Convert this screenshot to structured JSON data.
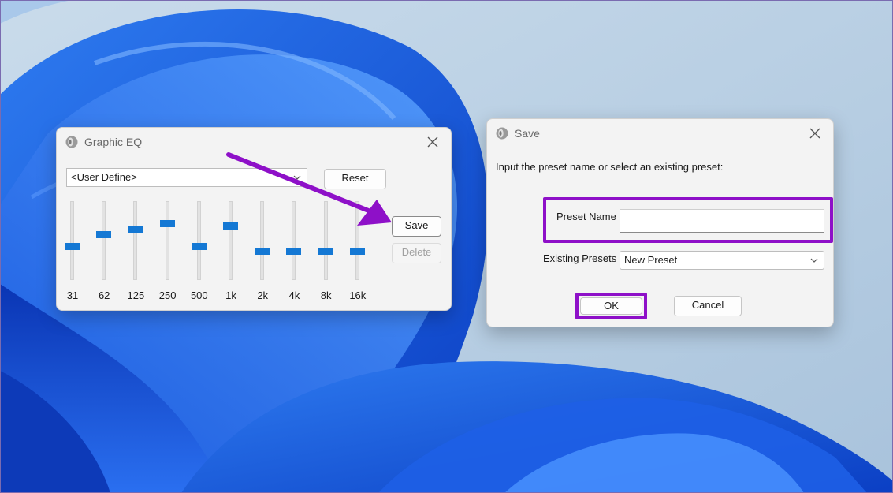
{
  "eq_window": {
    "title": "Graphic EQ",
    "preset_selected": "<User Define>",
    "reset_label": "Reset",
    "save_label": "Save",
    "delete_label": "Delete",
    "bands": [
      {
        "label": "31",
        "level": 0.57
      },
      {
        "label": "62",
        "level": 0.42
      },
      {
        "label": "125",
        "level": 0.35
      },
      {
        "label": "250",
        "level": 0.28
      },
      {
        "label": "500",
        "level": 0.57
      },
      {
        "label": "1k",
        "level": 0.31
      },
      {
        "label": "2k",
        "level": 0.63
      },
      {
        "label": "4k",
        "level": 0.63
      },
      {
        "label": "8k",
        "level": 0.63
      },
      {
        "label": "16k",
        "level": 0.63
      }
    ]
  },
  "save_dialog": {
    "title": "Save",
    "instruction": "Input the preset name or select an existing preset:",
    "preset_name_label": "Preset Name",
    "preset_name_value": "",
    "existing_presets_label": "Existing Presets",
    "existing_presets_selected": "New Preset",
    "ok_label": "OK",
    "cancel_label": "Cancel"
  },
  "colors": {
    "annotation_purple": "#8e10c8",
    "slider_thumb": "#1478d4"
  },
  "icons": [
    "speaker-icon",
    "close-icon",
    "chevron-down-icon"
  ]
}
